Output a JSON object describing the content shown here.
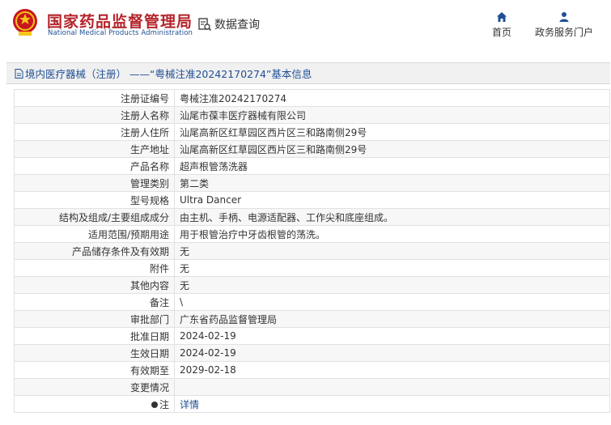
{
  "site": {
    "title": "国家药品监督管理局",
    "subtitle": "National Medical Products Administration",
    "query_link": "数据查询"
  },
  "nav": [
    {
      "label": "首页",
      "icon": "home-icon"
    },
    {
      "label": "政务服务门户",
      "icon": "user-icon"
    }
  ],
  "panel": {
    "title": "境内医疗器械（注册） ——“粤械注准20242170274”基本信息"
  },
  "rows": [
    {
      "label": "注册证编号",
      "value": "粤械注准20242170274"
    },
    {
      "label": "注册人名称",
      "value": "汕尾市葆丰医疗器械有限公司"
    },
    {
      "label": "注册人住所",
      "value": "汕尾高新区红草园区西片区三和路南侧29号"
    },
    {
      "label": "生产地址",
      "value": "汕尾高新区红草园区西片区三和路南侧29号"
    },
    {
      "label": "产品名称",
      "value": "超声根管荡洗器"
    },
    {
      "label": "管理类别",
      "value": "第二类"
    },
    {
      "label": "型号规格",
      "value": "Ultra Dancer"
    },
    {
      "label": "结构及组成/主要组成成分",
      "value": "由主机、手柄、电源适配器、工作尖和底座组成。"
    },
    {
      "label": "适用范围/预期用途",
      "value": "用于根管治疗中牙齿根管的荡洗。"
    },
    {
      "label": "产品储存条件及有效期",
      "value": "无"
    },
    {
      "label": "附件",
      "value": "无"
    },
    {
      "label": "其他内容",
      "value": "无"
    },
    {
      "label": "备注",
      "value": "\\"
    },
    {
      "label": "审批部门",
      "value": "广东省药品监督管理局"
    },
    {
      "label": "批准日期",
      "value": "2024-02-19"
    },
    {
      "label": "生效日期",
      "value": "2024-02-19"
    },
    {
      "label": "有效期至",
      "value": "2029-02-18"
    },
    {
      "label": "变更情况",
      "value": ""
    }
  ],
  "note_row": {
    "label": "注",
    "link": "详情"
  },
  "colors": {
    "brand_red": "#b5242b",
    "brand_blue": "#1f4f94"
  }
}
